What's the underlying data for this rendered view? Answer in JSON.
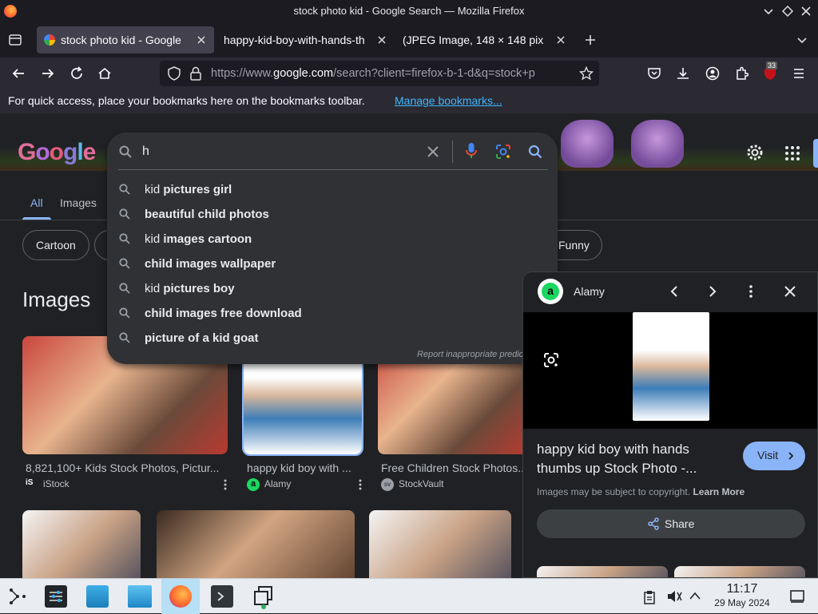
{
  "window": {
    "title": "stock photo kid - Google Search — Mozilla Firefox"
  },
  "tabs": [
    {
      "label": "stock photo kid - Google"
    },
    {
      "label": "happy-kid-boy-with-hands-th"
    },
    {
      "label": "(JPEG Image, 148 × 148 pix"
    }
  ],
  "address": {
    "prefix": "https://www.",
    "domain": "google.com",
    "rest": "/search?client=firefox-b-1-d&q=stock+p"
  },
  "extension_badge": "33",
  "bookmarks_bar": {
    "text": "For quick access, place your bookmarks here on the bookmarks toolbar.",
    "link": "Manage bookmarks..."
  },
  "google": {
    "logo": "Google",
    "search_value": "h",
    "tabs": [
      {
        "label": "All"
      },
      {
        "label": "Images"
      }
    ],
    "chips": [
      {
        "label": "Cartoon"
      },
      {
        "label": "Funny"
      }
    ],
    "images_heading": "Images",
    "suggestions": [
      {
        "plain": "kid ",
        "bold": "pictures girl",
        "plain2": ""
      },
      {
        "plain": "",
        "bold": "beautiful child photos",
        "plain2": ""
      },
      {
        "plain": "kid ",
        "bold": "images cartoon",
        "plain2": ""
      },
      {
        "plain": "",
        "bold": "child images wallpaper",
        "plain2": ""
      },
      {
        "plain": "kid ",
        "bold": "pictures boy",
        "plain2": ""
      },
      {
        "plain": "",
        "bold": "child images free download",
        "plain2": ""
      },
      {
        "plain": "",
        "bold": "picture of a ",
        "plain2": "kid goat"
      }
    ],
    "report_text": "Report inappropriate predic",
    "results": [
      {
        "caption": "8,821,100+ Kids Stock Photos, Pictur...",
        "source": "iStock",
        "source_icon": "iS"
      },
      {
        "caption": "happy kid boy with ...",
        "source": "Alamy",
        "source_icon": "a"
      },
      {
        "caption": "Free Children Stock Photos...",
        "source": "StockVault",
        "source_icon": "sv"
      }
    ]
  },
  "preview": {
    "site": "Alamy",
    "site_icon": "a",
    "title": "happy kid boy with hands thumbs up Stock Photo -...",
    "visit": "Visit",
    "copyright": "Images may be subject to copyright.",
    "learn_more": "Learn More",
    "share": "Share"
  },
  "taskbar": {
    "time": "11:17",
    "date": "29 May 2024"
  },
  "colors": {
    "accent": "#8ab4f8",
    "link": "#1f8fff",
    "alamy_green": "#1bd760"
  }
}
